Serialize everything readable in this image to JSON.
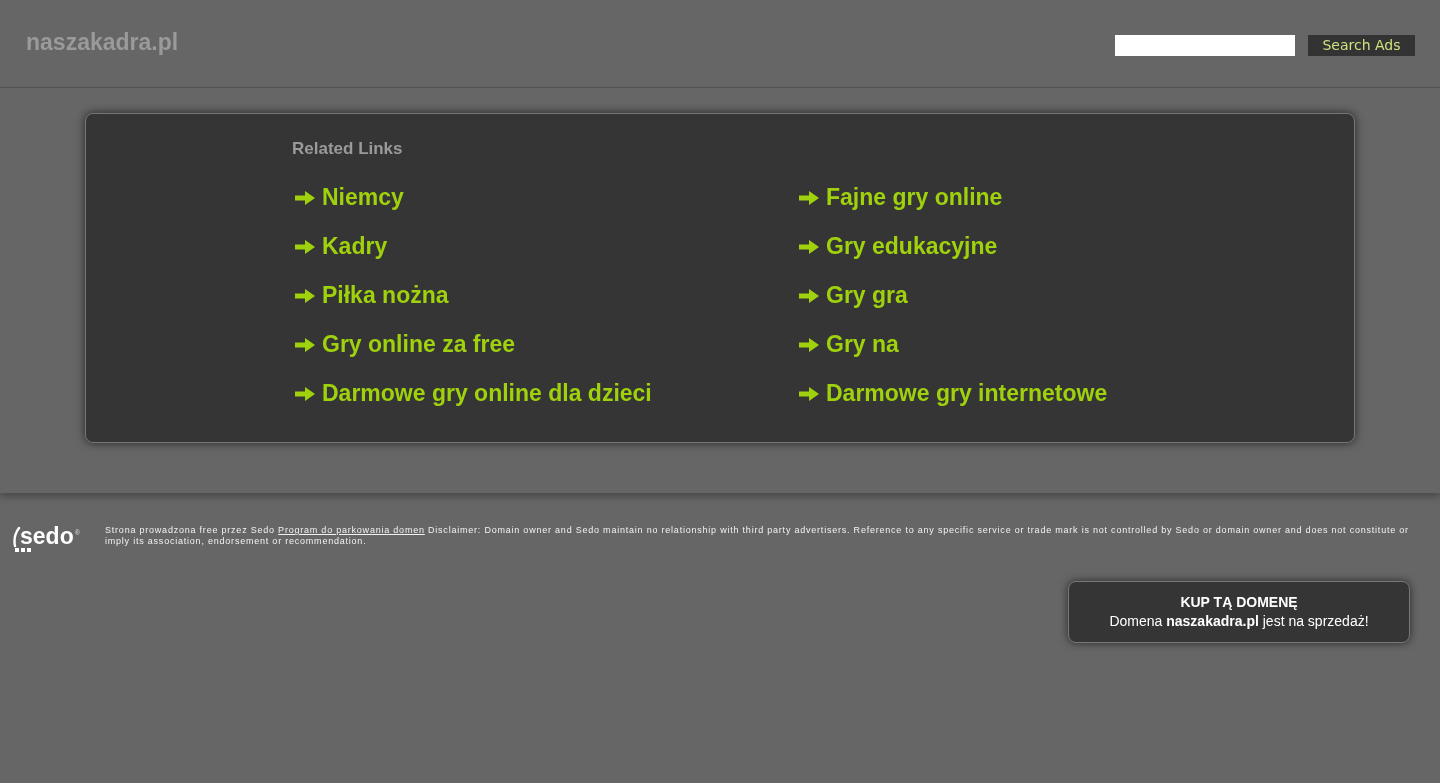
{
  "header": {
    "domain": "naszakadra.pl",
    "search": {
      "button": "Search Ads"
    }
  },
  "related": {
    "title": "Related Links",
    "columns": [
      {
        "links": [
          "Niemcy",
          "Kadry",
          "Piłka nożna",
          "Gry online za free",
          "Darmowe gry online dla dzieci"
        ]
      },
      {
        "links": [
          "Fajne gry online",
          "Gry edukacyjne",
          "Gry gra",
          "Gry na",
          "Darmowe gry internetowe"
        ]
      }
    ]
  },
  "footer": {
    "logo": {
      "text": "sedo",
      "mark": "®"
    },
    "notice": {
      "before": "Strona prowadzona free przez Sedo",
      "link": "Program do parkowania domen",
      "after": "Disclaimer: Domain owner and Sedo maintain no relationship with third party advertisers. Reference to any specific service or trade mark is not controlled by Sedo or domain owner and does not constitute or imply its association, endorsement or recommendation."
    }
  },
  "sale": {
    "title": "KUP TĄ DOMENĘ",
    "text": "Domena **naszakadra.pl** jest na sprzedaż!"
  }
}
